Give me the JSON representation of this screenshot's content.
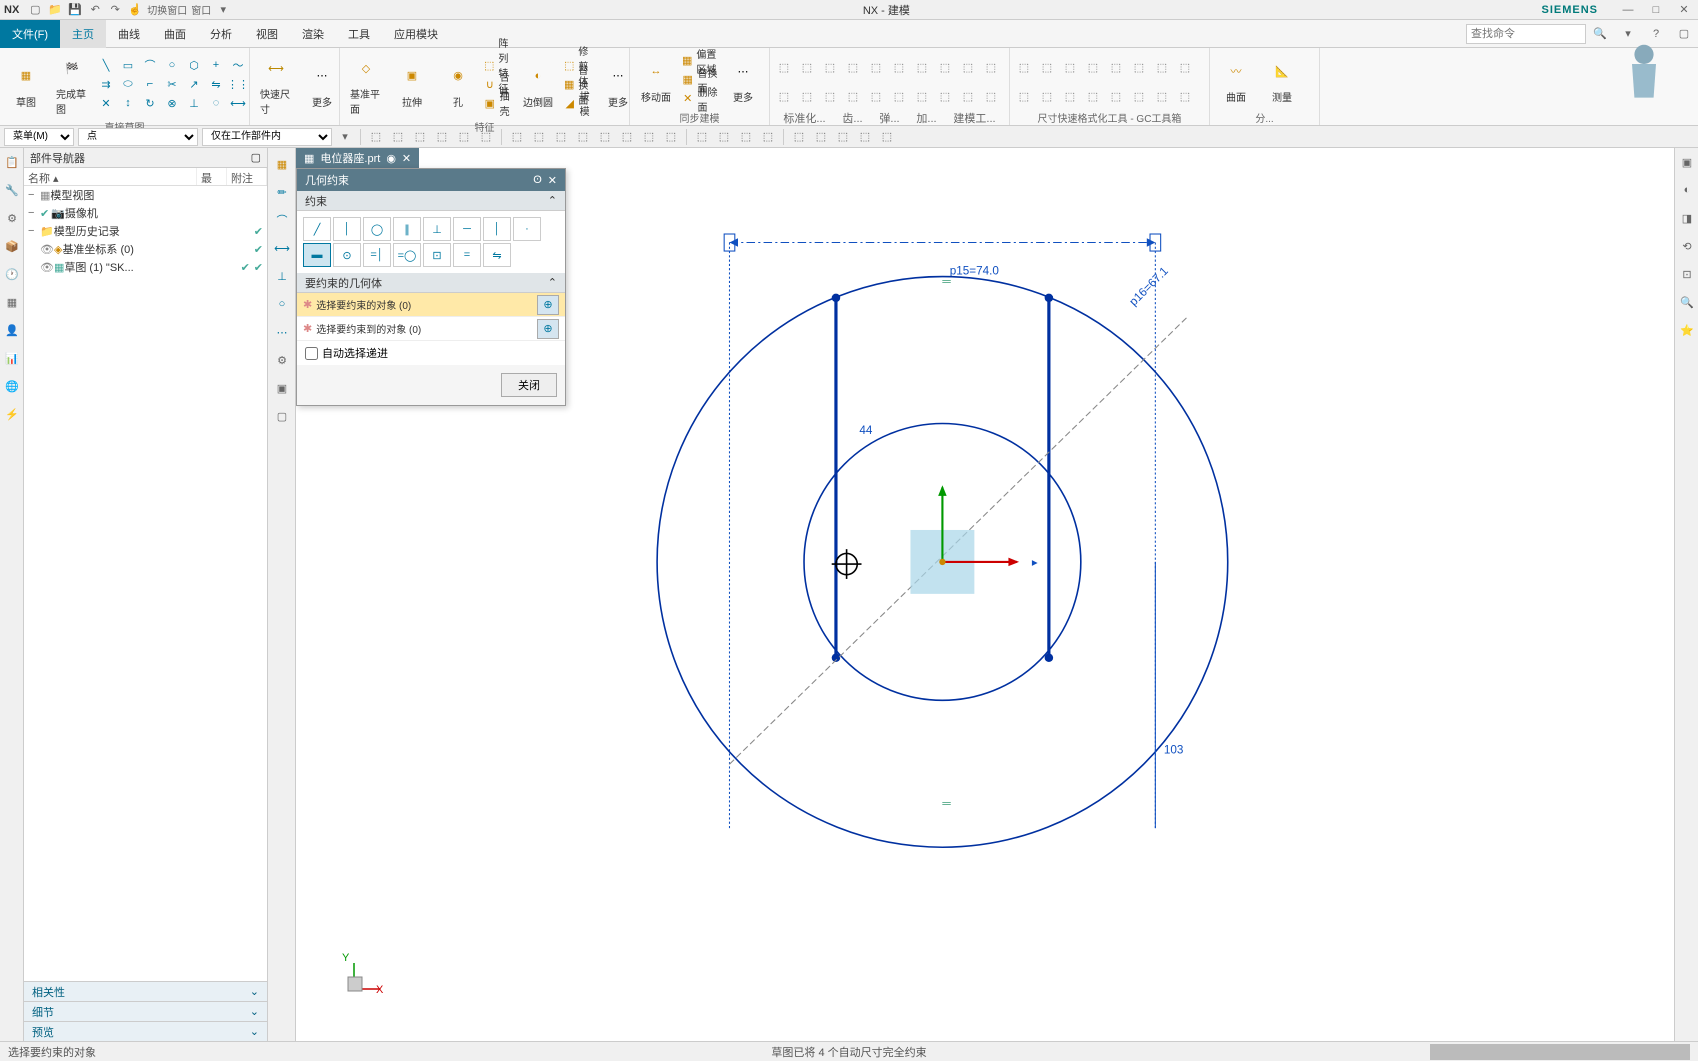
{
  "title": {
    "app": "NX",
    "center": "NX - 建模",
    "brand": "SIEMENS"
  },
  "qat_icons": [
    "new-icon",
    "open-icon",
    "save-icon",
    "undo-icon",
    "redo-icon",
    "menu-down-icon"
  ],
  "qat_label": "切换窗口",
  "qat_label2": "窗口",
  "menu": {
    "file": "文件(F)",
    "tabs": [
      "主页",
      "曲线",
      "曲面",
      "分析",
      "视图",
      "渲染",
      "工具",
      "应用模块"
    ],
    "search_ph": "查找命令"
  },
  "ribbon": {
    "sketch_group": {
      "sketch": "草图",
      "finish": "完成草图",
      "label": "直接草图"
    },
    "feature_group": {
      "datum": "基准平面",
      "extrude": "拉伸",
      "hole": "孔",
      "pattern": "阵列特征",
      "unite": "合并",
      "shell": "抽壳",
      "chamfer": "边倒圆",
      "trim": "修剪体",
      "draft": "拔模",
      "more": "更多",
      "label": "特征"
    },
    "sync_group": {
      "move_face": "移动面",
      "delete_face": "删除面",
      "offset_region": "偏置区域",
      "replace_face": "替换面",
      "more": "更多",
      "label": "同步建模"
    },
    "quick_group": {
      "quick": "快速尺寸",
      "more": "更多"
    },
    "surface_group": {
      "surface": "曲面",
      "measure": "测量"
    },
    "labels": {
      "std": "标准化...",
      "chi": "齿...",
      "spr": "弹...",
      "add": "加...",
      "model": "建模工...",
      "gc": "尺寸快速格式化工具 - GC工具箱",
      "analysis": "分..."
    }
  },
  "selbar": {
    "menu_label": "菜单(M)",
    "dropdown1": "点",
    "dropdown2": "仅在工作部件内"
  },
  "nav": {
    "title": "部件导航器",
    "cols": {
      "c1": "名称",
      "c2": "最",
      "c3": "附注"
    },
    "tree": [
      {
        "level": 0,
        "icon": "-",
        "text": "模型视图"
      },
      {
        "level": 0,
        "icon": "-",
        "chk": true,
        "text": "摄像机"
      },
      {
        "level": 0,
        "icon": "-",
        "text": "模型历史记录",
        "mark": true
      },
      {
        "level": 1,
        "vis": true,
        "text": "基准坐标系 (0)",
        "mark": true
      },
      {
        "level": 1,
        "vis": true,
        "text": "草图 (1) \"SK...",
        "mark": true,
        "mark2": true
      }
    ],
    "footer": [
      "相关性",
      "细节",
      "预览"
    ]
  },
  "dialog": {
    "title": "几何约束",
    "section1": "约束",
    "section2": "要约束的几何体",
    "sel1": "选择要约束的对象 (0)",
    "sel2": "选择要约束到的对象 (0)",
    "auto": "自动选择递进",
    "close": "关闭"
  },
  "file_tab": {
    "name": "电位器座.prt",
    "mod": "◉"
  },
  "sketch_dims": {
    "top": "p15=74.0",
    "angle": "p16=67.1",
    "height": "44",
    "cx_label": "103"
  },
  "status": {
    "left": "选择要约束的对象",
    "center": "草图已将 4 个自动尺寸完全约束"
  },
  "colors": {
    "accent": "#0078a0",
    "sketch_blue": "#0030a0",
    "dim_blue": "#1050c0",
    "construction": "#888"
  }
}
